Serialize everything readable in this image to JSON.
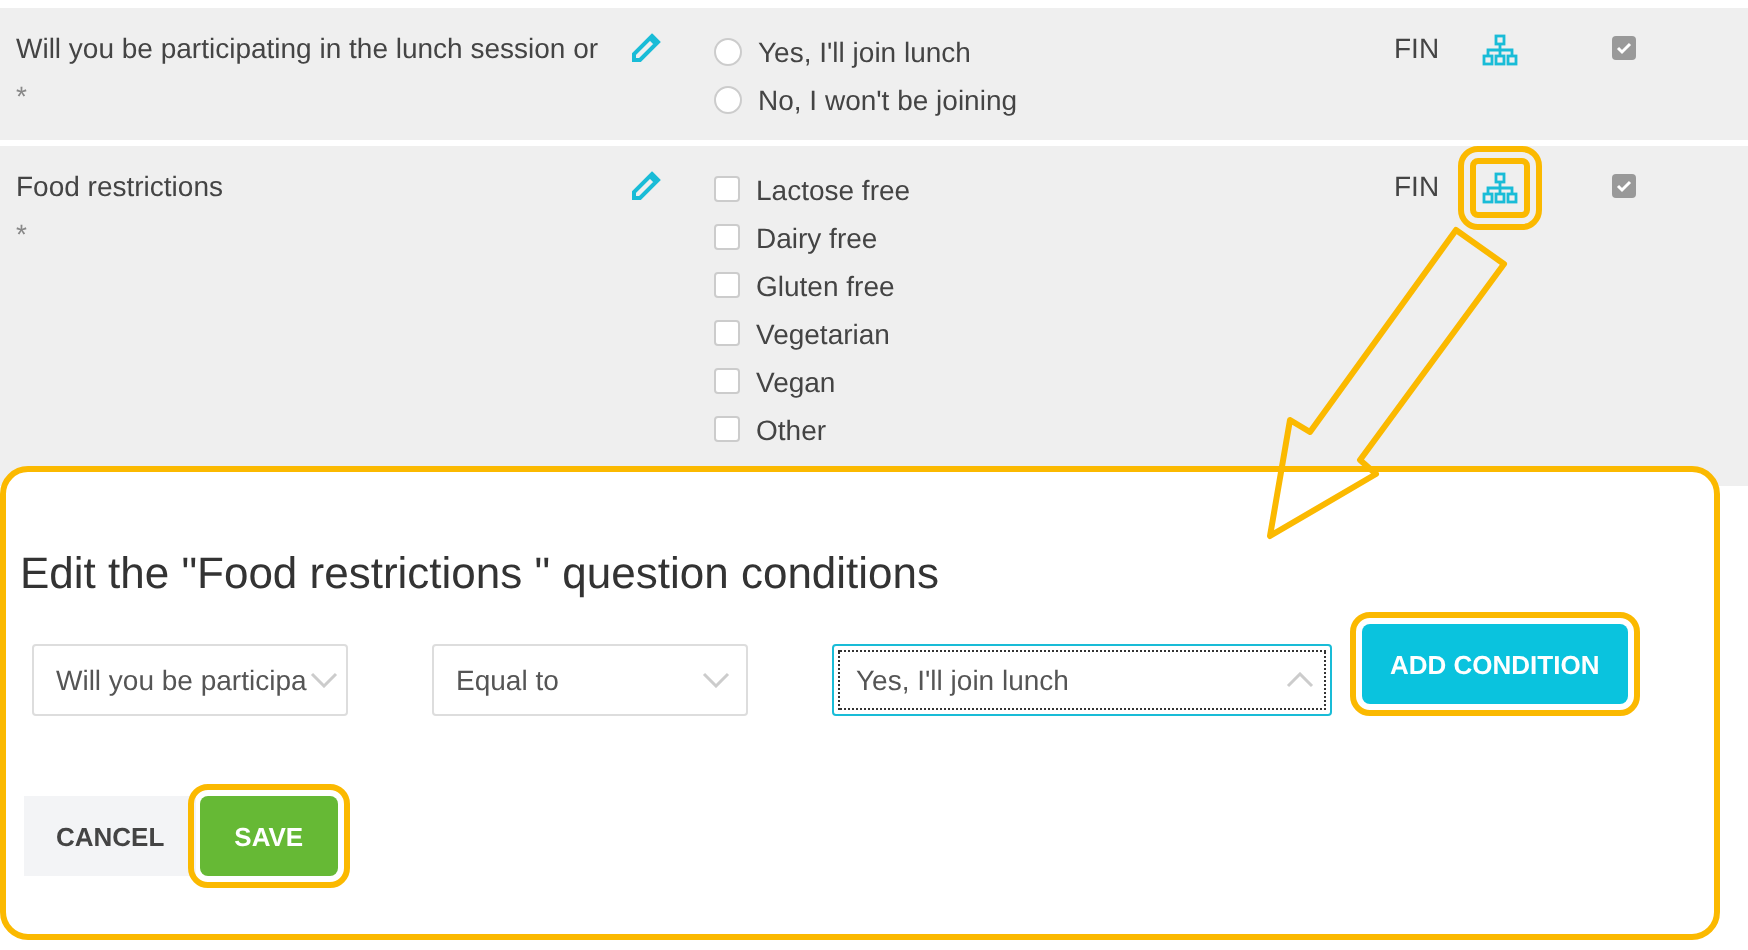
{
  "questions": [
    {
      "label": "Will you be participating in the lunch session or",
      "required_mark": "*",
      "kind": "radio",
      "options": [
        {
          "label": "Yes, I'll join lunch",
          "selected": false
        },
        {
          "label": "No, I won't be joining",
          "selected": false
        }
      ],
      "language": "FIN",
      "conditions_highlighted": false,
      "enabled": true
    },
    {
      "label": "Food restrictions",
      "required_mark": "*",
      "kind": "checkbox",
      "options": [
        {
          "label": "Lactose free",
          "checked": false
        },
        {
          "label": "Dairy free",
          "checked": false
        },
        {
          "label": "Gluten free",
          "checked": false
        },
        {
          "label": "Vegetarian",
          "checked": false
        },
        {
          "label": "Vegan",
          "checked": false
        },
        {
          "label": "Other",
          "checked": false
        }
      ],
      "language": "FIN",
      "conditions_highlighted": true,
      "enabled": true
    }
  ],
  "dialog": {
    "title": "Edit the \"Food restrictions \" question conditions",
    "question_select": {
      "value": "Will you be participa"
    },
    "operator_select": {
      "value": "Equal to"
    },
    "answer_select": {
      "value": "Yes, I'll join lunch",
      "focused": true
    },
    "add_button": {
      "label": "ADD CONDITION",
      "highlighted": true
    },
    "cancel_button": {
      "label": "CANCEL"
    },
    "save_button": {
      "label": "SAVE",
      "highlighted": true
    }
  }
}
